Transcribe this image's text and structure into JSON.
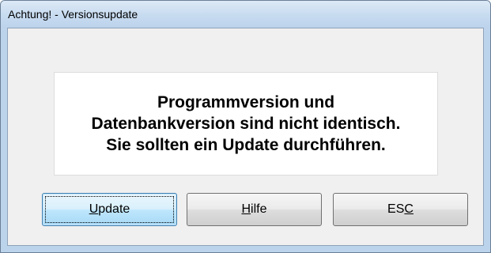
{
  "window": {
    "title": "Achtung! - Versionsupdate"
  },
  "message": {
    "line1": "Programmversion und",
    "line2": "Datenbankversion sind nicht identisch.",
    "line3": "Sie sollten ein Update durchführen."
  },
  "buttons": {
    "update": {
      "mnemonic": "U",
      "rest": "pdate"
    },
    "hilfe": {
      "mnemonic": "H",
      "rest": "ilfe"
    },
    "esc": {
      "before": "ES",
      "mnemonic": "C"
    }
  },
  "colors": {
    "titlebar": "#c7dbf0",
    "client_background": "#f0f0f0",
    "message_background": "#ffffff",
    "default_button_border": "#3c7fb1"
  }
}
